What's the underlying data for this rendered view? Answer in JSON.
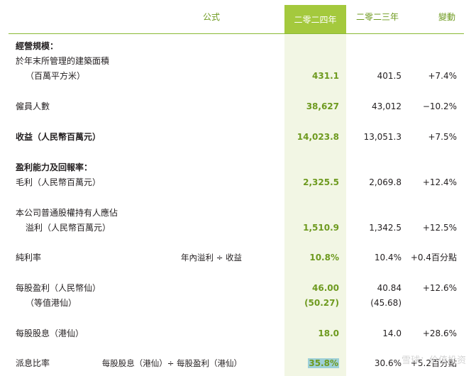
{
  "header": {
    "formula": "公式",
    "year_2024": "二零二四年",
    "year_2023": "二零二三年",
    "change": "變動"
  },
  "rows": {
    "scale_title": "經營規模：",
    "gfa_label_1": "於年末所管理的建築面積",
    "gfa_label_2": "（百萬平方米）",
    "gfa_2024": "431.1",
    "gfa_2023": "401.5",
    "gfa_change": "+7.4%",
    "emp_label": "僱員人數",
    "emp_2024": "38,627",
    "emp_2023": "43,012",
    "emp_change": "−10.2%",
    "rev_label": "收益（人民幣百萬元）",
    "rev_2024": "14,023.8",
    "rev_2023": "13,051.3",
    "rev_change": "+7.5%",
    "profit_title": "盈利能力及回報率：",
    "gp_label": "毛利（人民幣百萬元）",
    "gp_2024": "2,325.5",
    "gp_2023": "2,069.8",
    "gp_change": "+12.4%",
    "np_label_1": "本公司普通股權持有人應佔",
    "np_label_2": "溢利（人民幣百萬元）",
    "np_2024": "1,510.9",
    "np_2023": "1,342.5",
    "np_change": "+12.5%",
    "npm_label": "純利率",
    "npm_formula": "年內溢利 ÷ 收益",
    "npm_2024": "10.8%",
    "npm_2023": "10.4%",
    "npm_change": "+0.4百分點",
    "eps_label": "每股盈利（人民幣仙）",
    "eps_2024": "46.00",
    "eps_2023": "40.84",
    "eps_change": "+12.6%",
    "eps_hk_label": "（等值港仙）",
    "eps_hk_2024": "(50.27)",
    "eps_hk_2023": "(45.68)",
    "dps_label": "每股股息（港仙）",
    "dps_2024": "18.0",
    "dps_2023": "14.0",
    "dps_change": "+28.6%",
    "payout_label": "派息比率",
    "payout_formula": "每股股息（港仙）÷ 每股盈利（港仙）",
    "payout_2024": "35.8%",
    "payout_2023": "30.6%",
    "payout_change": "+5.2百分點"
  },
  "watermark": "雪球：价值投资"
}
